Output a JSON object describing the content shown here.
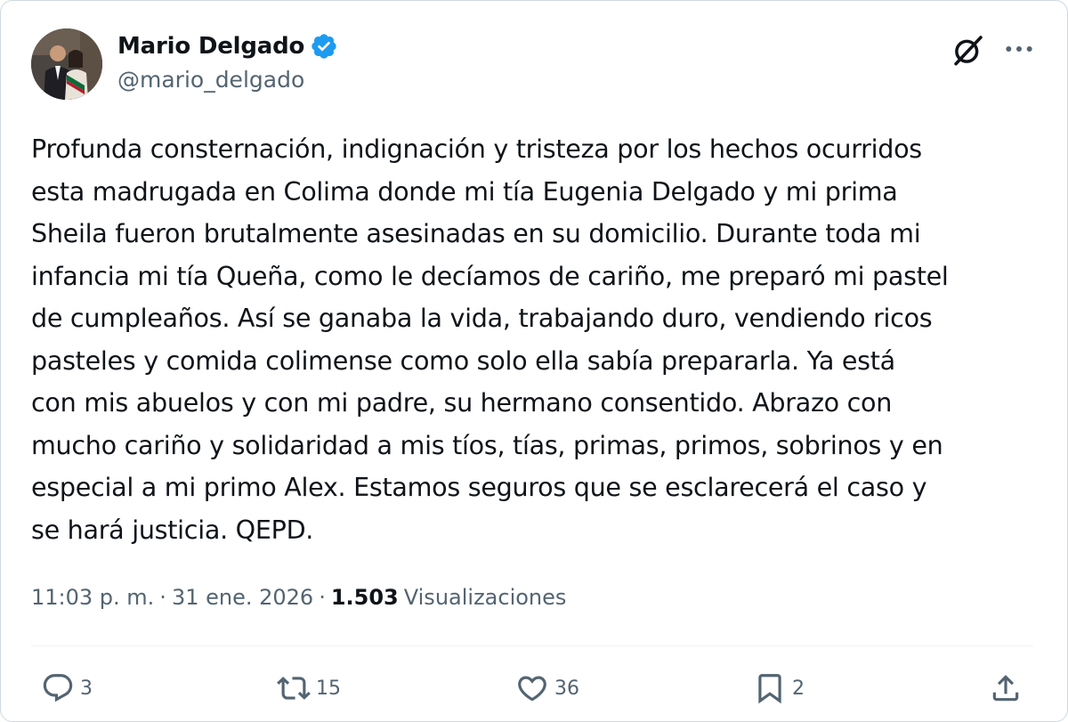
{
  "author": {
    "name": "Mario Delgado",
    "handle": "@mario_delgado",
    "verified_icon": "verified-badge-icon",
    "verified_color": "#1d9bf0"
  },
  "header_actions": {
    "grok_icon": "grok-icon",
    "more_icon": "more-options-icon"
  },
  "tweet": {
    "text": "Profunda consternación, indignación y tristeza por los hechos ocurridos\nesta madrugada en Colima donde mi tía Eugenia Delgado y mi prima\nSheila fueron brutalmente asesinadas en su domicilio. Durante toda mi\ninfancia mi tía Queña, como le decíamos de cariño, me preparó mi pastel\nde cumpleaños. Así se ganaba la vida, trabajando duro, vendiendo ricos\npasteles y comida colimense como solo ella sabía prepararla. Ya está\ncon mis abuelos y con mi padre, su hermano consentido. Abrazo con\nmucho cariño y solidaridad a mis tíos, tías, primas, primos, sobrinos y en\nespecial a mi primo Alex. Estamos seguros que se esclarecerá el caso y\nse hará justicia. QEPD.",
    "time": "11:03 p. m.",
    "separator": "·",
    "date": "31 ene. 2026",
    "views_count": "1.503",
    "views_label": "Visualizaciones"
  },
  "actions": {
    "reply": {
      "icon": "reply-icon",
      "count": "3"
    },
    "retweet": {
      "icon": "retweet-icon",
      "count": "15"
    },
    "like": {
      "icon": "heart-icon",
      "count": "36"
    },
    "bookmark": {
      "icon": "bookmark-icon",
      "count": "2"
    },
    "share": {
      "icon": "share-icon"
    }
  },
  "colors": {
    "text_primary": "#0f1419",
    "text_secondary": "#536471",
    "accent": "#1d9bf0",
    "divider": "#eff3f4"
  }
}
